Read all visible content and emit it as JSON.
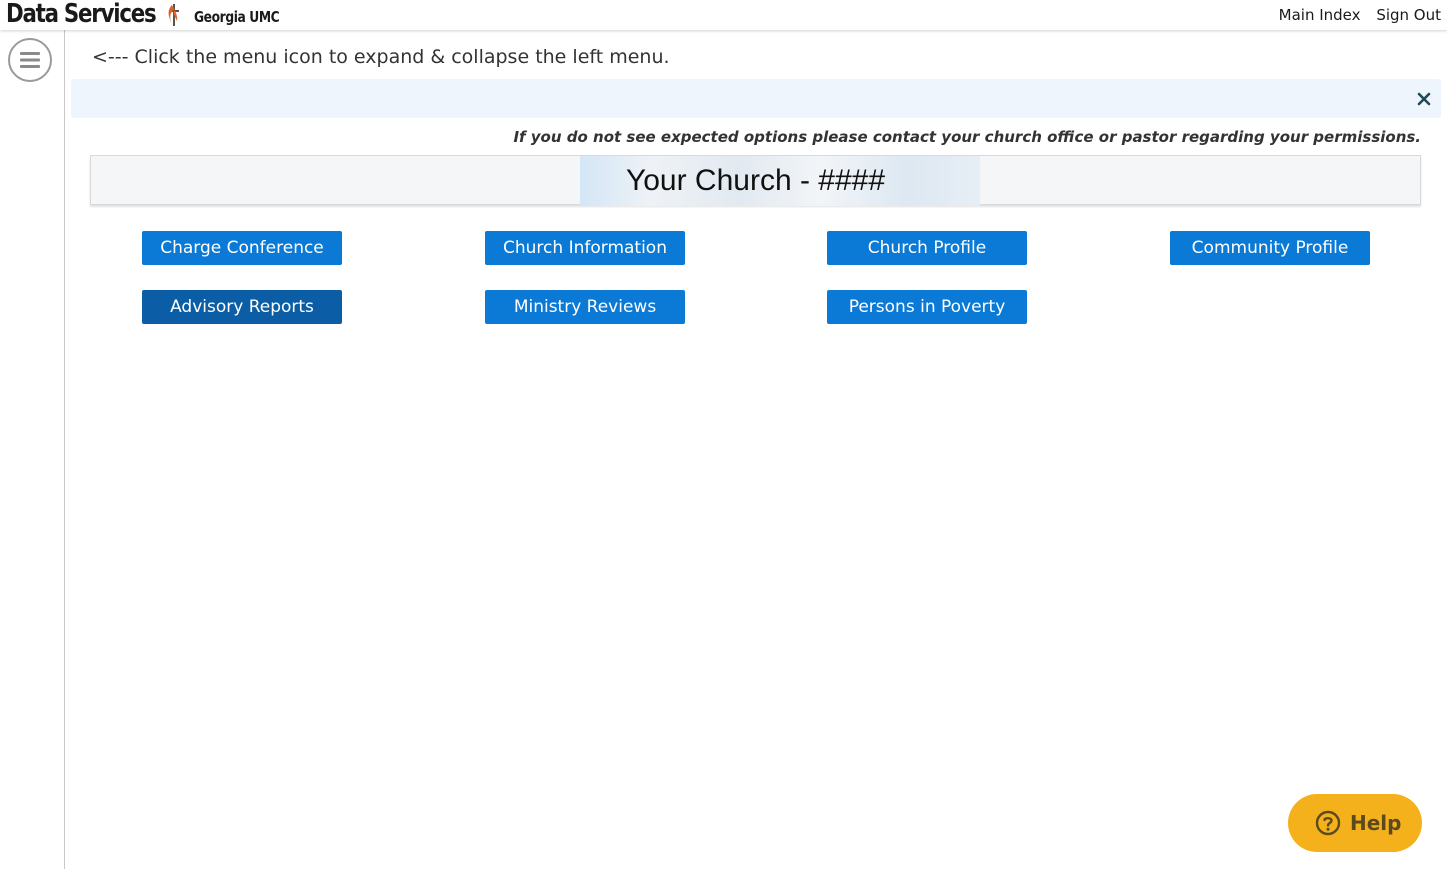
{
  "header": {
    "title": "Data Services",
    "conference": "Georgia UMC",
    "links": {
      "main_index": "Main Index",
      "sign_out": "Sign Out"
    }
  },
  "sidebar": {
    "toggle_icon": "hamburger-menu-icon"
  },
  "main": {
    "hint": "<--- Click the menu icon to expand & collapse the left menu.",
    "alert": {
      "close_icon": "close-icon"
    },
    "permission_note": "If you do not see expected options please contact your church office or pastor regarding your permissions.",
    "church_title": "Your Church - ####",
    "buttons": {
      "charge_conference": "Charge Conference",
      "church_information": "Church Information",
      "church_profile": "Church Profile",
      "community_profile": "Community Profile",
      "advisory_reports": "Advisory Reports",
      "ministry_reviews": "Ministry Reviews",
      "persons_in_poverty": "Persons in Poverty"
    }
  },
  "help": {
    "label": "Help",
    "icon": "question-circle-icon"
  },
  "colors": {
    "button_blue": "#0a7ad6",
    "button_blue_dark": "#0b5ea6",
    "alert_bg": "#eef5fc",
    "help_yellow": "#f5b11c",
    "flame_orange": "#e0612a"
  }
}
